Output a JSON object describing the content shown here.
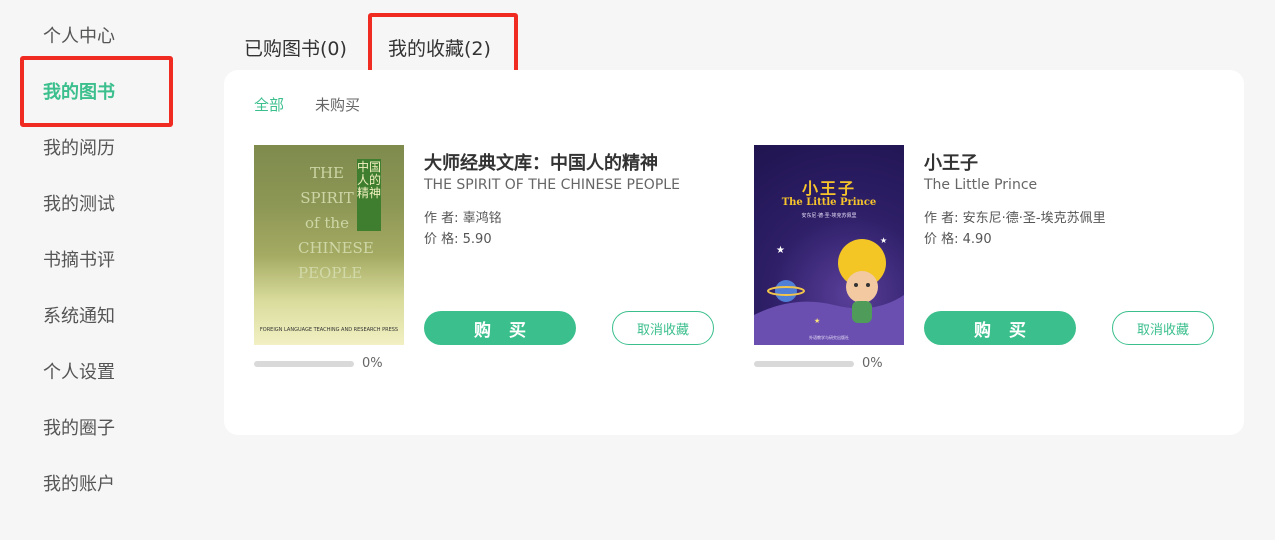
{
  "sidebar": {
    "items": [
      {
        "label": "个人中心"
      },
      {
        "label": "我的图书"
      },
      {
        "label": "我的阅历"
      },
      {
        "label": "我的测试"
      },
      {
        "label": "书摘书评"
      },
      {
        "label": "系统通知"
      },
      {
        "label": "个人设置"
      },
      {
        "label": "我的圈子"
      },
      {
        "label": "我的账户"
      }
    ],
    "active_index": 1
  },
  "tabs": [
    {
      "label": "已购图书(0)"
    },
    {
      "label": "我的收藏(2)"
    }
  ],
  "active_tab": 1,
  "filters": [
    {
      "label": "全部"
    },
    {
      "label": "未购买"
    }
  ],
  "books": [
    {
      "title": "大师经典文库：中国人的精神",
      "subtitle": "THE SPIRIT OF THE CHINESE PEOPLE",
      "author": "作 者: 辜鸿铭",
      "price": "价 格:   5.90",
      "buy_label": "购买",
      "unfav_label": "取消收藏",
      "progress_text": "0%",
      "progress": 0,
      "cover": {
        "big_text": "THE SPIRIT of the CHINESE PEOPLE",
        "band_text": "中国人的精神",
        "publisher": "FOREIGN LANGUAGE TEACHING AND RESEARCH PRESS"
      }
    },
    {
      "title": "小王子",
      "subtitle": "The Little Prince",
      "author": "作 者: 安东尼·德·圣-埃克苏佩里",
      "price": "价 格:   4.90",
      "buy_label": "购买",
      "unfav_label": "取消收藏",
      "progress_text": "0%",
      "progress": 0,
      "cover": {
        "title_cn": "小王子",
        "title_en": "The Little Prince",
        "author_line": "安东尼·德·圣-埃克苏佩里",
        "publisher": "外语教学与研究出版社"
      }
    }
  ],
  "colors": {
    "accent": "#3bbf8d",
    "highlight_box": "#f02b22",
    "background": "#f7f6f7"
  }
}
